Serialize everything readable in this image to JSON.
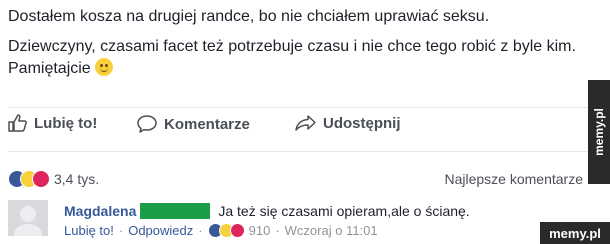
{
  "post": {
    "line1": "Dostałem kosza na drugiej randce, bo nie chciałem uprawiać seksu.",
    "line2": "Dziewczyny, czasami facet też potrzebuje czasu i nie chce tego robić z byle kim. Pamiętajcie"
  },
  "actions": {
    "like": "Lubię to!",
    "comment": "Komentarze",
    "share": "Udostępnij"
  },
  "reactions": {
    "count": "3,4 tys.",
    "top_comments": "Najlepsze komentarze"
  },
  "comment": {
    "author": "Magdalena",
    "text": "Ja też się czasami opieram,ale o ścianę.",
    "like": "Lubię to!",
    "reply": "Odpowiedz",
    "reaction_count": "910",
    "time": "Wczoraj o 11:01"
  },
  "watermarks": {
    "side": "memy.pl",
    "bottom": "memy.pl"
  }
}
